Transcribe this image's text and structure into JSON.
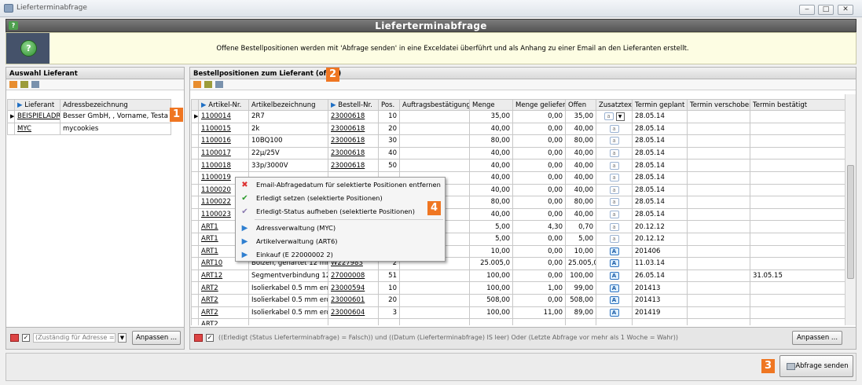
{
  "window": {
    "title": "Lieferterminabfrage",
    "min": "‒",
    "max": "□",
    "close": "✕"
  },
  "banner": {
    "title": "Lieferterminabfrage",
    "icon": "help-icon"
  },
  "info": {
    "text": "Offene Bestellpositionen werden mit 'Abfrage senden' in eine Exceldatei überführt und als Anhang zu einer Email an den Lieferanten erstellt.",
    "icon": "question-icon"
  },
  "left": {
    "title": "Auswahl Lieferant",
    "columns": [
      "Lieferant",
      "Adressbezeichnung"
    ],
    "rows": [
      [
        "BEISPIELADRI",
        "Besser GmbH, , Vorname, Testa"
      ],
      [
        "MYC",
        "mycookies"
      ]
    ],
    "filter": "(Zuständig für Adresse =",
    "button": "Anpassen ..."
  },
  "right": {
    "title": "Bestellpositionen zum Lieferant (offen)",
    "columns": [
      "Artikel-Nr.",
      "Artikelbezeichnung",
      "Bestell-Nr.",
      "Pos.",
      "Auftragsbestätigungs",
      "Menge",
      "Menge geliefert",
      "Offen",
      "Zusatztext",
      "Termin geplant",
      "Termin verschoben",
      "Termin bestätigt"
    ],
    "rows": [
      [
        "1100014",
        "2R7",
        "23000618",
        "10",
        "",
        "35,00",
        "0,00",
        "35,00",
        "a",
        "28.05.14",
        "",
        ""
      ],
      [
        "1100015",
        "2k",
        "23000618",
        "20",
        "",
        "40,00",
        "0,00",
        "40,00",
        "a",
        "28.05.14",
        "",
        ""
      ],
      [
        "1100016",
        "10BQ100",
        "23000618",
        "30",
        "",
        "80,00",
        "0,00",
        "80,00",
        "a",
        "28.05.14",
        "",
        ""
      ],
      [
        "1100017",
        "22µ/25V",
        "23000618",
        "40",
        "",
        "40,00",
        "0,00",
        "40,00",
        "a",
        "28.05.14",
        "",
        ""
      ],
      [
        "1100018",
        "33p/3000V",
        "23000618",
        "50",
        "",
        "40,00",
        "0,00",
        "40,00",
        "a",
        "28.05.14",
        "",
        ""
      ],
      [
        "1100019",
        "",
        "",
        "",
        "",
        "40,00",
        "0,00",
        "40,00",
        "a",
        "28.05.14",
        "",
        ""
      ],
      [
        "1100020",
        "",
        "",
        "",
        "",
        "40,00",
        "0,00",
        "40,00",
        "a",
        "28.05.14",
        "",
        ""
      ],
      [
        "1100022",
        "",
        "",
        "",
        "",
        "80,00",
        "0,00",
        "80,00",
        "a",
        "28.05.14",
        "",
        ""
      ],
      [
        "1100023",
        "",
        "",
        "",
        "",
        "40,00",
        "0,00",
        "40,00",
        "a",
        "28.05.14",
        "",
        ""
      ],
      [
        "ART1",
        "",
        "",
        "",
        "",
        "5,00",
        "4,30",
        "0,70",
        "a",
        "20.12.12",
        "",
        ""
      ],
      [
        "ART1",
        "",
        "",
        "",
        "",
        "5,00",
        "0,00",
        "5,00",
        "a",
        "20.12.12",
        "",
        ""
      ],
      [
        "ART1",
        "",
        "",
        "",
        "",
        "10,00",
        "0,00",
        "10,00",
        "A",
        "201406",
        "",
        ""
      ],
      [
        "ART10",
        "Bolzen, gehärtet 12 mm",
        "W227983",
        "2",
        "",
        "25.005,0",
        "0,00",
        "25.005,0",
        "A",
        "11.03.14",
        "",
        ""
      ],
      [
        "ART12",
        "Segmentverbindung 12",
        "27000008",
        "51",
        "",
        "100,00",
        "0,00",
        "100,00",
        "A",
        "26.05.14",
        "",
        "31.05.15"
      ],
      [
        "ART2",
        "Isolierkabel 0.5 mm erd",
        "23000594",
        "10",
        "",
        "100,00",
        "1,00",
        "99,00",
        "A",
        "201413",
        "",
        ""
      ],
      [
        "ART2",
        "Isolierkabel 0.5 mm erd",
        "23000601",
        "20",
        "",
        "508,00",
        "0,00",
        "508,00",
        "A",
        "201413",
        "",
        ""
      ],
      [
        "ART2",
        "Isolierkabel 0.5 mm erd",
        "23000604",
        "3",
        "",
        "100,00",
        "11,00",
        "89,00",
        "A",
        "201419",
        "",
        ""
      ],
      [
        "ART2",
        "",
        "",
        "",
        "",
        "",
        "",
        "",
        "",
        "",
        "",
        ""
      ]
    ],
    "filter": "((Erledigt (Status Lieferterminabfrage) = Falsch)) und ((Datum (Lieferterminabfrage) IS leer) Oder (Letzte Abfrage vor mehr als 1 Woche = Wahr))",
    "button": "Anpassen ..."
  },
  "context_menu": [
    {
      "label": "Email-Abfragedatum für selektierte Positionen entfernen",
      "icon": "red-x-icon"
    },
    {
      "label": "Erledigt setzen (selektierte Positionen)",
      "icon": "green-check-icon"
    },
    {
      "label": "Erledigt-Status aufheben (selektierte Positionen)",
      "icon": "purple-check-icon"
    },
    {
      "label": "Adressverwaltung  (MYC)",
      "icon": "arrow-right-icon"
    },
    {
      "label": "Artikelverwaltung  (ART6)",
      "icon": "arrow-right-icon"
    },
    {
      "label": "Einkauf  (E 22000002 2)",
      "icon": "arrow-right-icon"
    }
  ],
  "badges": [
    "1",
    "2",
    "3",
    "4"
  ],
  "send_button": "Abfrage senden",
  "colors": {
    "badge": "#ef7622",
    "banner": "#666666",
    "info_bg": "#fdfde3"
  }
}
